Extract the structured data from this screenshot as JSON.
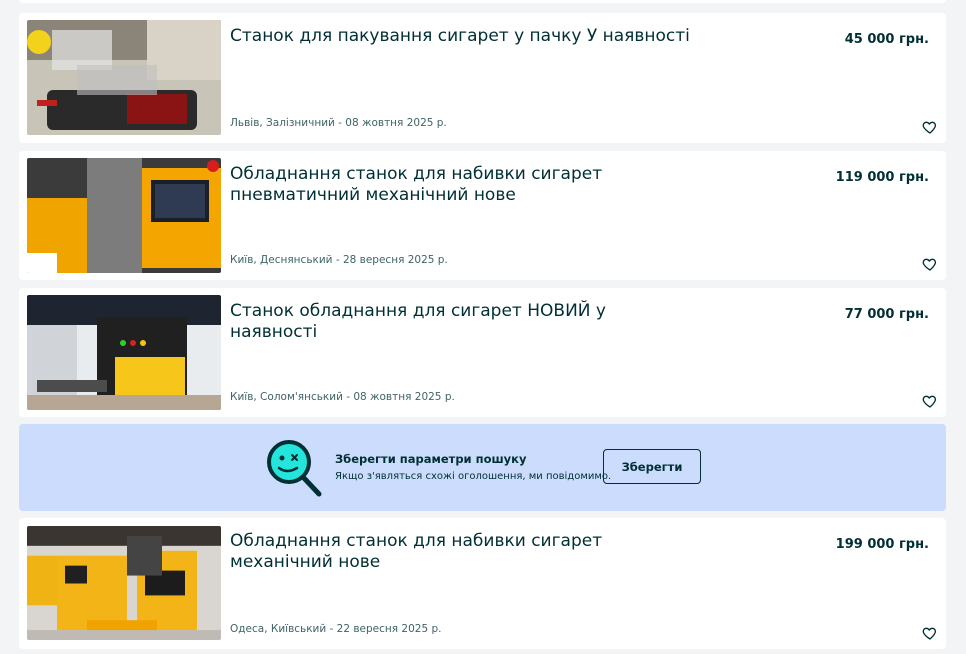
{
  "listings": [
    {
      "title": "Станок для пакування сигарет у пачку У наявності",
      "price": "45 000 грн.",
      "location_date": "Львів, Залізничний - 08 жовтня 2025 р."
    },
    {
      "title": "Обладнання станок для набивки сигарет пневматичний механічний нове",
      "price": "119 000 грн.",
      "location_date": "Київ, Деснянський - 28 вересня 2025 р."
    },
    {
      "title": "Станок обладнання для сигарет НОВИЙ у наявності",
      "price": "77 000 грн.",
      "location_date": "Київ, Солом'янський - 08 жовтня 2025 р."
    },
    {
      "title": "Обладнання станок для набивки сигарет механічний нове",
      "price": "199 000 грн.",
      "location_date": "Одеса, Київський - 22 вересня 2025 р."
    }
  ],
  "save_search": {
    "title": "Зберегти параметри пошуку",
    "subtitle": "Якщо з'являться схожі оголошення, ми повідомимо.",
    "button_label": "Зберегти"
  },
  "colors": {
    "text": "#002f34",
    "card_bg": "#ffffff",
    "page_bg": "#f2f4f5",
    "banner_bg": "#ccdcfd"
  },
  "icons": [
    "heart-outline-icon",
    "search-face-icon"
  ]
}
